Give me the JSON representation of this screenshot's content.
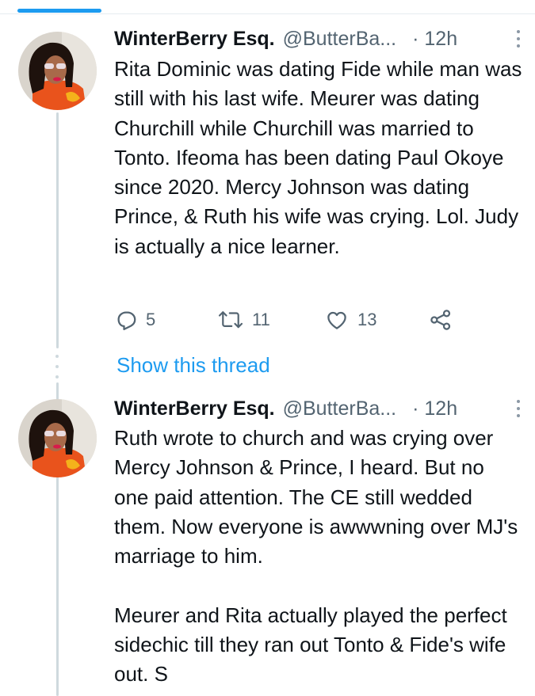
{
  "tab_indicator_color": "#1d9bf0",
  "tweets": [
    {
      "display_name": "WinterBerry Esq.",
      "handle": "@ButterBa...",
      "time": "· 12h",
      "text": "Rita Dominic was dating Fide while man was still with his last wife. Meurer was dating Churchill while Churchill was married to Tonto. Ifeoma has been dating Paul Okoye since 2020. Mercy Johnson was dating Prince, & Ruth his wife was crying. Lol. Judy is actually a nice learner.",
      "actions": {
        "reply_count": "5",
        "retweet_count": "11",
        "like_count": "13"
      }
    },
    {
      "display_name": "WinterBerry Esq.",
      "handle": "@ButterBa...",
      "time": "· 12h",
      "text": "Ruth wrote to church and was crying over Mercy Johnson & Prince, I heard. But no one paid attention. The CE still wedded them. Now everyone is awwwning over MJ's marriage to him.\n\nMeurer and Rita actually played the perfect sidechic till they ran out Tonto & Fide's wife out. S"
    }
  ],
  "show_thread_label": "Show this thread",
  "icons": {
    "reply": "reply-icon",
    "retweet": "retweet-icon",
    "like": "heart-icon",
    "share": "share-icon",
    "more": "more-icon"
  },
  "colors": {
    "text": "#0f1419",
    "secondary": "#536471",
    "link": "#1d9bf0",
    "thread_line": "#cfd9de"
  }
}
